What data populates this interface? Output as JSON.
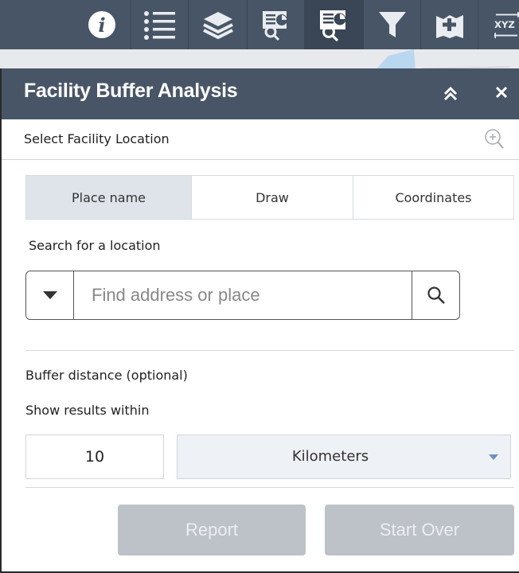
{
  "toolbar": {
    "items": [
      {
        "icon": "info-icon"
      },
      {
        "icon": "list-icon"
      },
      {
        "icon": "layers-icon"
      },
      {
        "icon": "report-icon"
      },
      {
        "icon": "facility-buffer-icon",
        "active": true
      },
      {
        "icon": "filter-icon"
      },
      {
        "icon": "add-data-icon"
      },
      {
        "icon": "xyz-coordinate-icon",
        "label": "XYZ"
      }
    ]
  },
  "panel": {
    "title": "Facility Buffer Analysis",
    "section_label": "Select Facility Location",
    "tabs": [
      "Place name",
      "Draw",
      "Coordinates"
    ],
    "active_tab": "Place name",
    "search": {
      "label": "Search for a location",
      "placeholder": "Find address or place"
    },
    "buffer": {
      "label": "Buffer distance (optional)",
      "within_label": "Show results within",
      "distance_value": "10",
      "unit": "Kilometers"
    },
    "buttons": {
      "report": "Report",
      "start_over": "Start Over"
    }
  },
  "colors": {
    "header_bg": "#485566",
    "tab_active_bg": "#dfe4ea",
    "button_disabled_bg": "#bdc2c8",
    "caret_blue": "#6e8fc4"
  }
}
